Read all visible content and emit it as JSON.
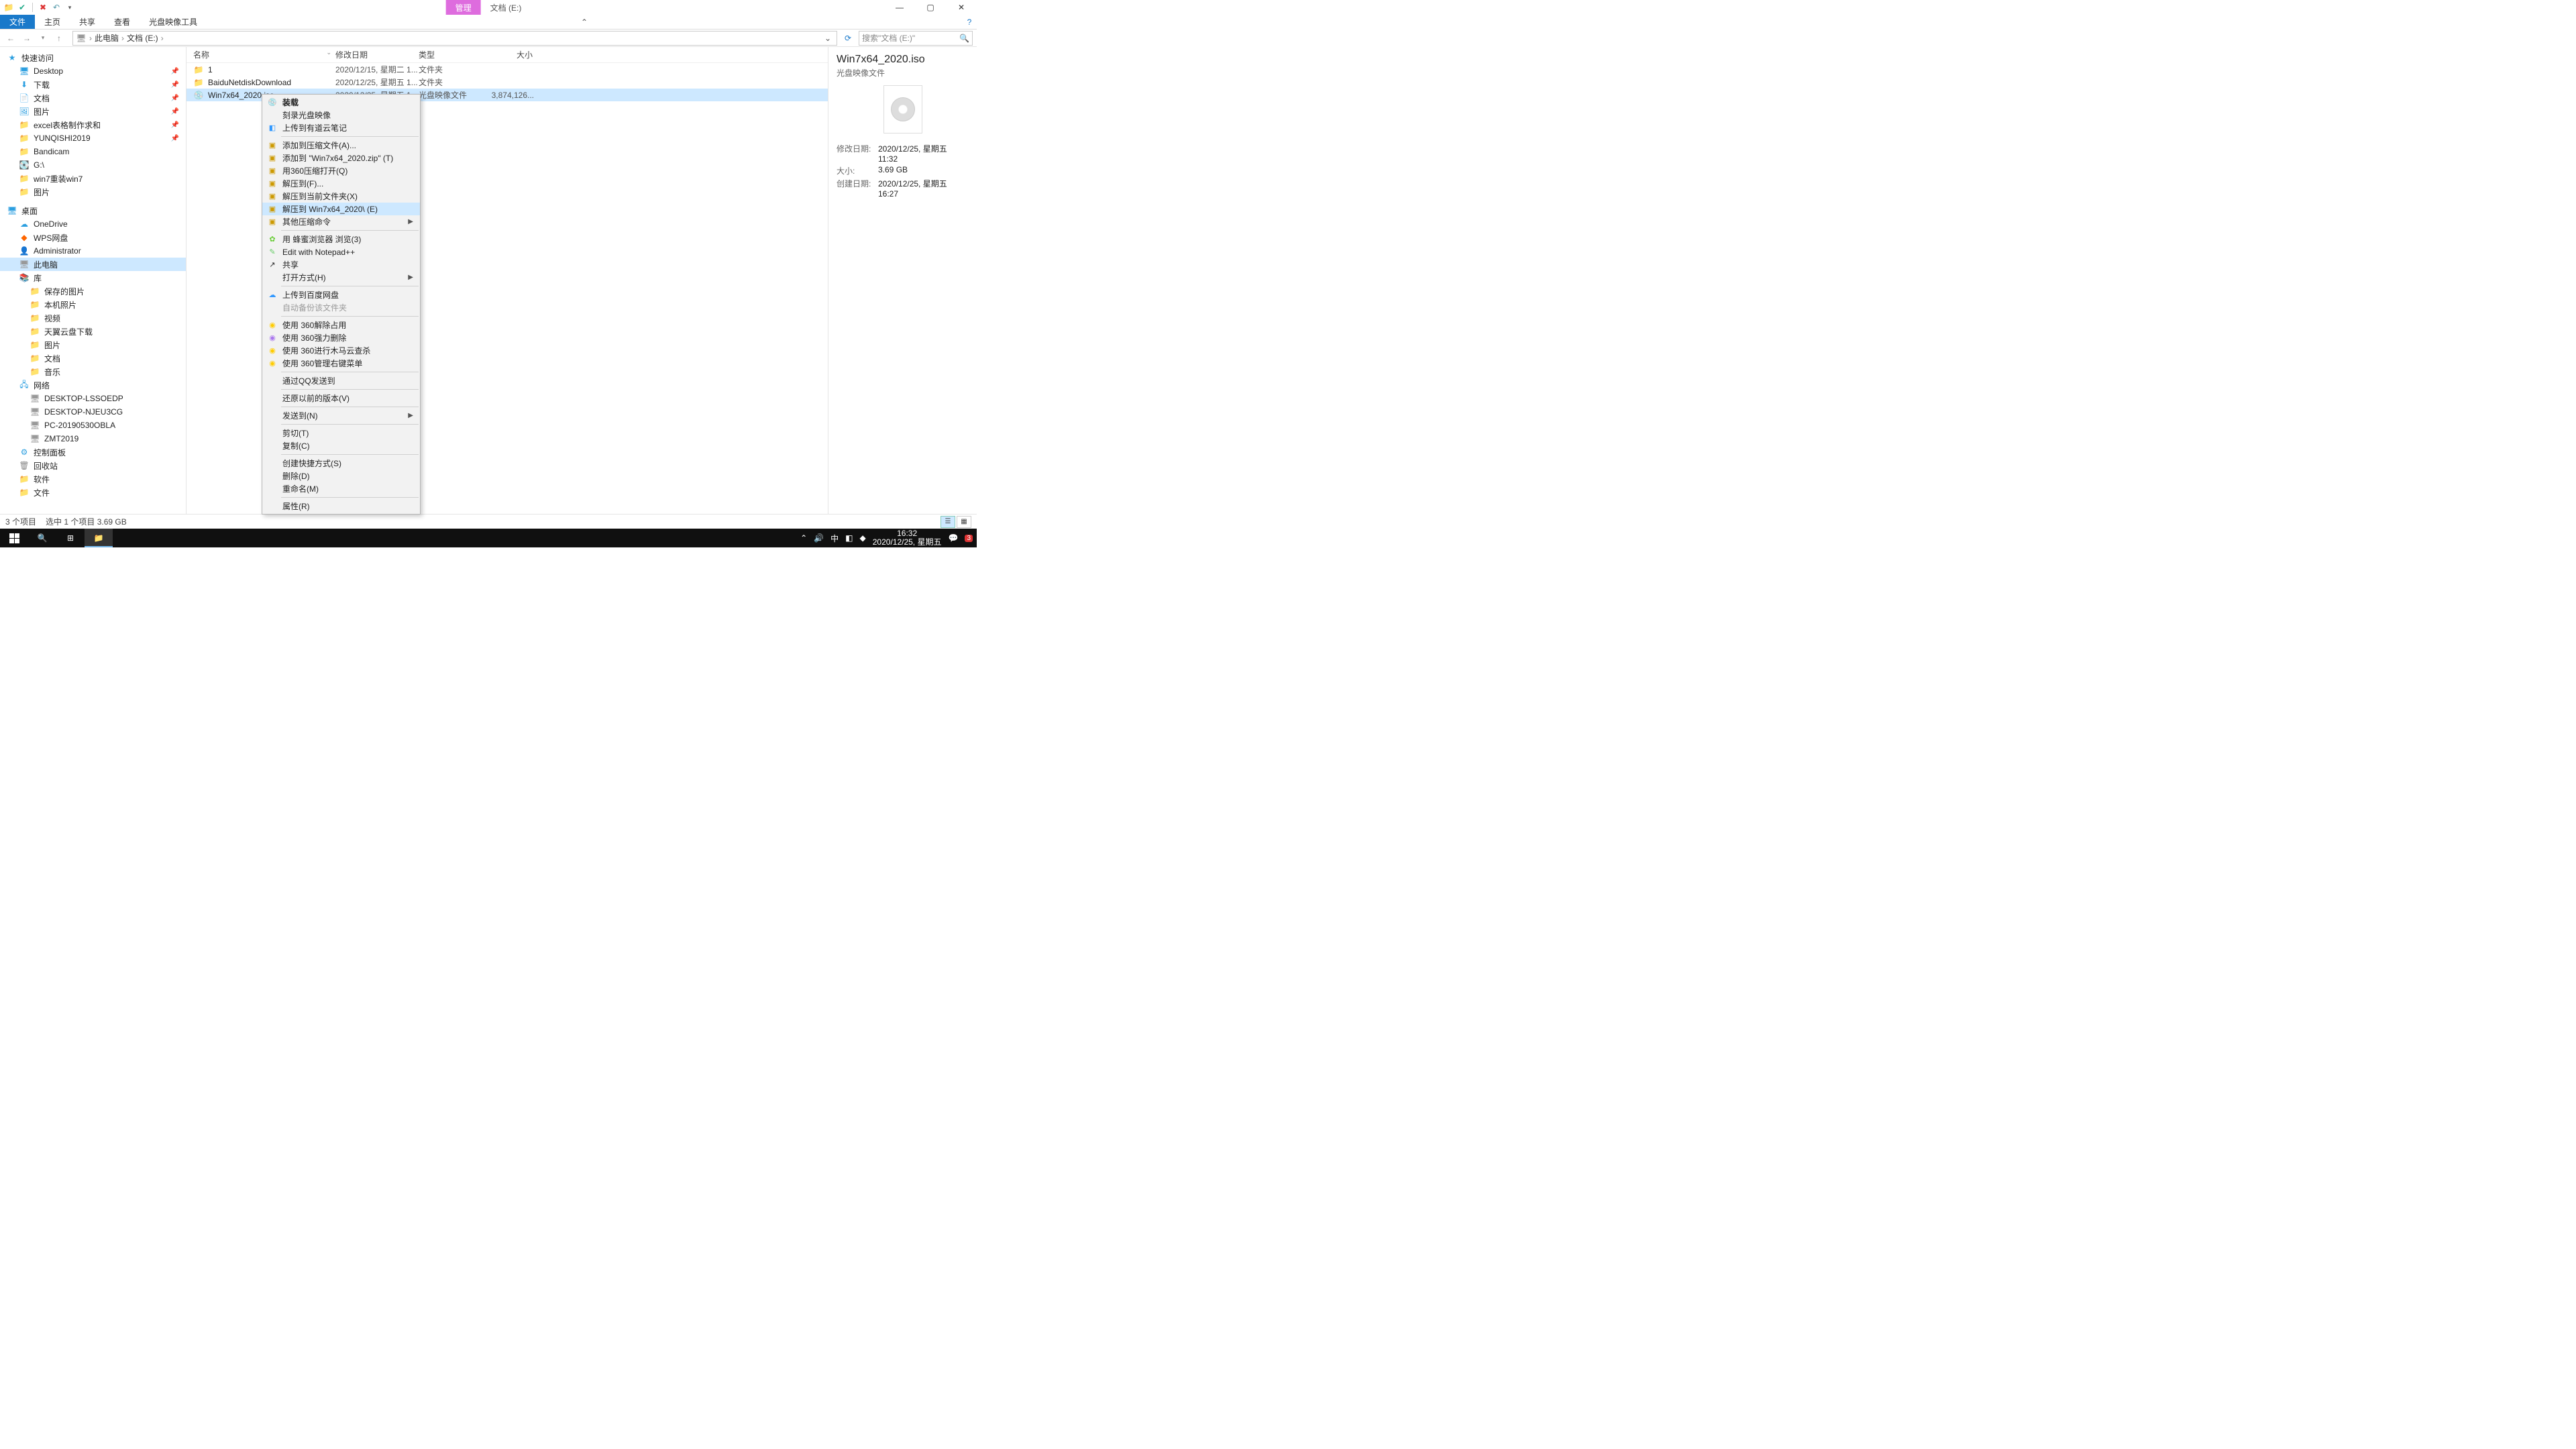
{
  "title_tabs": {
    "manage": "管理",
    "location": "文档 (E:)"
  },
  "ribbon": {
    "file": "文件",
    "home": "主页",
    "share": "共享",
    "view": "查看",
    "disc_tool": "光盘映像工具"
  },
  "breadcrumb": {
    "pc": "此电脑",
    "drive": "文档 (E:)"
  },
  "search_placeholder": "搜索\"文档 (E:)\"",
  "tree": {
    "quick": "快速访问",
    "desktop": "Desktop",
    "downloads": "下载",
    "documents": "文档",
    "pictures": "图片",
    "excel": "excel表格制作求和",
    "yunqishi": "YUNQISHI2019",
    "bandicam": "Bandicam",
    "gdrive": "G:\\",
    "win7reinstall": "win7重装win7",
    "pictures2": "图片",
    "desk_cn": "桌面",
    "onedrive": "OneDrive",
    "wps": "WPS网盘",
    "admin": "Administrator",
    "thispc": "此电脑",
    "lib": "库",
    "saved_pic": "保存的图片",
    "local_pic": "本机照片",
    "video": "视频",
    "tianyi": "天翼云盘下载",
    "pic3": "图片",
    "doc2": "文档",
    "music": "音乐",
    "network": "网络",
    "n1": "DESKTOP-LSSOEDP",
    "n2": "DESKTOP-NJEU3CG",
    "n3": "PC-20190530OBLA",
    "n4": "ZMT2019",
    "cpanel": "控制面板",
    "recycle": "回收站",
    "soft": "软件",
    "files": "文件"
  },
  "columns": {
    "name": "名称",
    "date": "修改日期",
    "type": "类型",
    "size": "大小"
  },
  "rows": [
    {
      "name": "1",
      "date": "2020/12/15, 星期二 1...",
      "type": "文件夹",
      "size": ""
    },
    {
      "name": "BaiduNetdiskDownload",
      "date": "2020/12/25, 星期五 1...",
      "type": "文件夹",
      "size": ""
    },
    {
      "name": "Win7x64_2020.iso",
      "date": "2020/12/25, 星期五 1...",
      "type": "光盘映像文件",
      "size": "3,874,126..."
    }
  ],
  "details": {
    "title": "Win7x64_2020.iso",
    "sub": "光盘映像文件",
    "k_mod": "修改日期:",
    "v_mod": "2020/12/25, 星期五 11:32",
    "k_size": "大小:",
    "v_size": "3.69 GB",
    "k_create": "创建日期:",
    "v_create": "2020/12/25, 星期五 16:27"
  },
  "ctx": {
    "mount": "装载",
    "burn": "刻录光盘映像",
    "youdao": "上传到有道云笔记",
    "add_archive": "添加到压缩文件(A)...",
    "add_zip": "添加到 \"Win7x64_2020.zip\" (T)",
    "open_360zip": "用360压缩打开(Q)",
    "extract_to": "解压到(F)...",
    "extract_here": "解压到当前文件夹(X)",
    "extract_named": "解压到 Win7x64_2020\\ (E)",
    "other_zip": "其他压缩命令",
    "bee_browser": "用 蜂蜜浏览器 浏览(3)",
    "npp": "Edit with Notepad++",
    "share": "共享",
    "open_with": "打开方式(H)",
    "baidu_upload": "上传到百度网盘",
    "auto_backup": "自动备份该文件夹",
    "u360_release": "使用 360解除占用",
    "u360_force_del": "使用 360强力删除",
    "u360_scan": "使用 360进行木马云查杀",
    "u360_menu": "使用 360管理右键菜单",
    "qq_send": "通过QQ发送到",
    "restore": "还原以前的版本(V)",
    "send_to": "发送到(N)",
    "cut": "剪切(T)",
    "copy": "复制(C)",
    "shortcut": "创建快捷方式(S)",
    "delete": "删除(D)",
    "rename": "重命名(M)",
    "props": "属性(R)"
  },
  "status": {
    "count": "3 个项目",
    "sel": "选中 1 个项目  3.69 GB"
  },
  "taskbar": {
    "time": "16:32",
    "date": "2020/12/25, 星期五",
    "ime": "中",
    "badge": "3"
  }
}
